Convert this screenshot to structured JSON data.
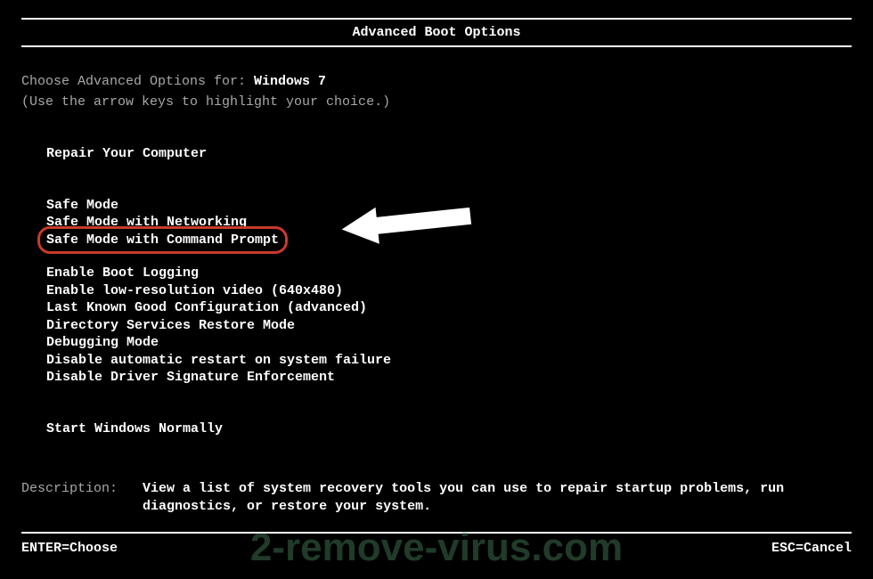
{
  "title": "Advanced Boot Options",
  "choose_prefix": "Choose Advanced Options for: ",
  "os_name": "Windows 7",
  "hint": "(Use the arrow keys to highlight your choice.)",
  "groups": {
    "repair": [
      "Repair Your Computer"
    ],
    "safe": [
      "Safe Mode",
      "Safe Mode with Networking",
      "Safe Mode with Command Prompt"
    ],
    "advanced": [
      "Enable Boot Logging",
      "Enable low-resolution video (640x480)",
      "Last Known Good Configuration (advanced)",
      "Directory Services Restore Mode",
      "Debugging Mode",
      "Disable automatic restart on system failure",
      "Disable Driver Signature Enforcement"
    ],
    "normal": [
      "Start Windows Normally"
    ]
  },
  "description_label": "Description:",
  "description_text": "View a list of system recovery tools you can use to repair startup problems, run diagnostics, or restore your system.",
  "footer_left": "ENTER=Choose",
  "footer_right": "ESC=Cancel",
  "watermark": "2-remove-virus.com"
}
